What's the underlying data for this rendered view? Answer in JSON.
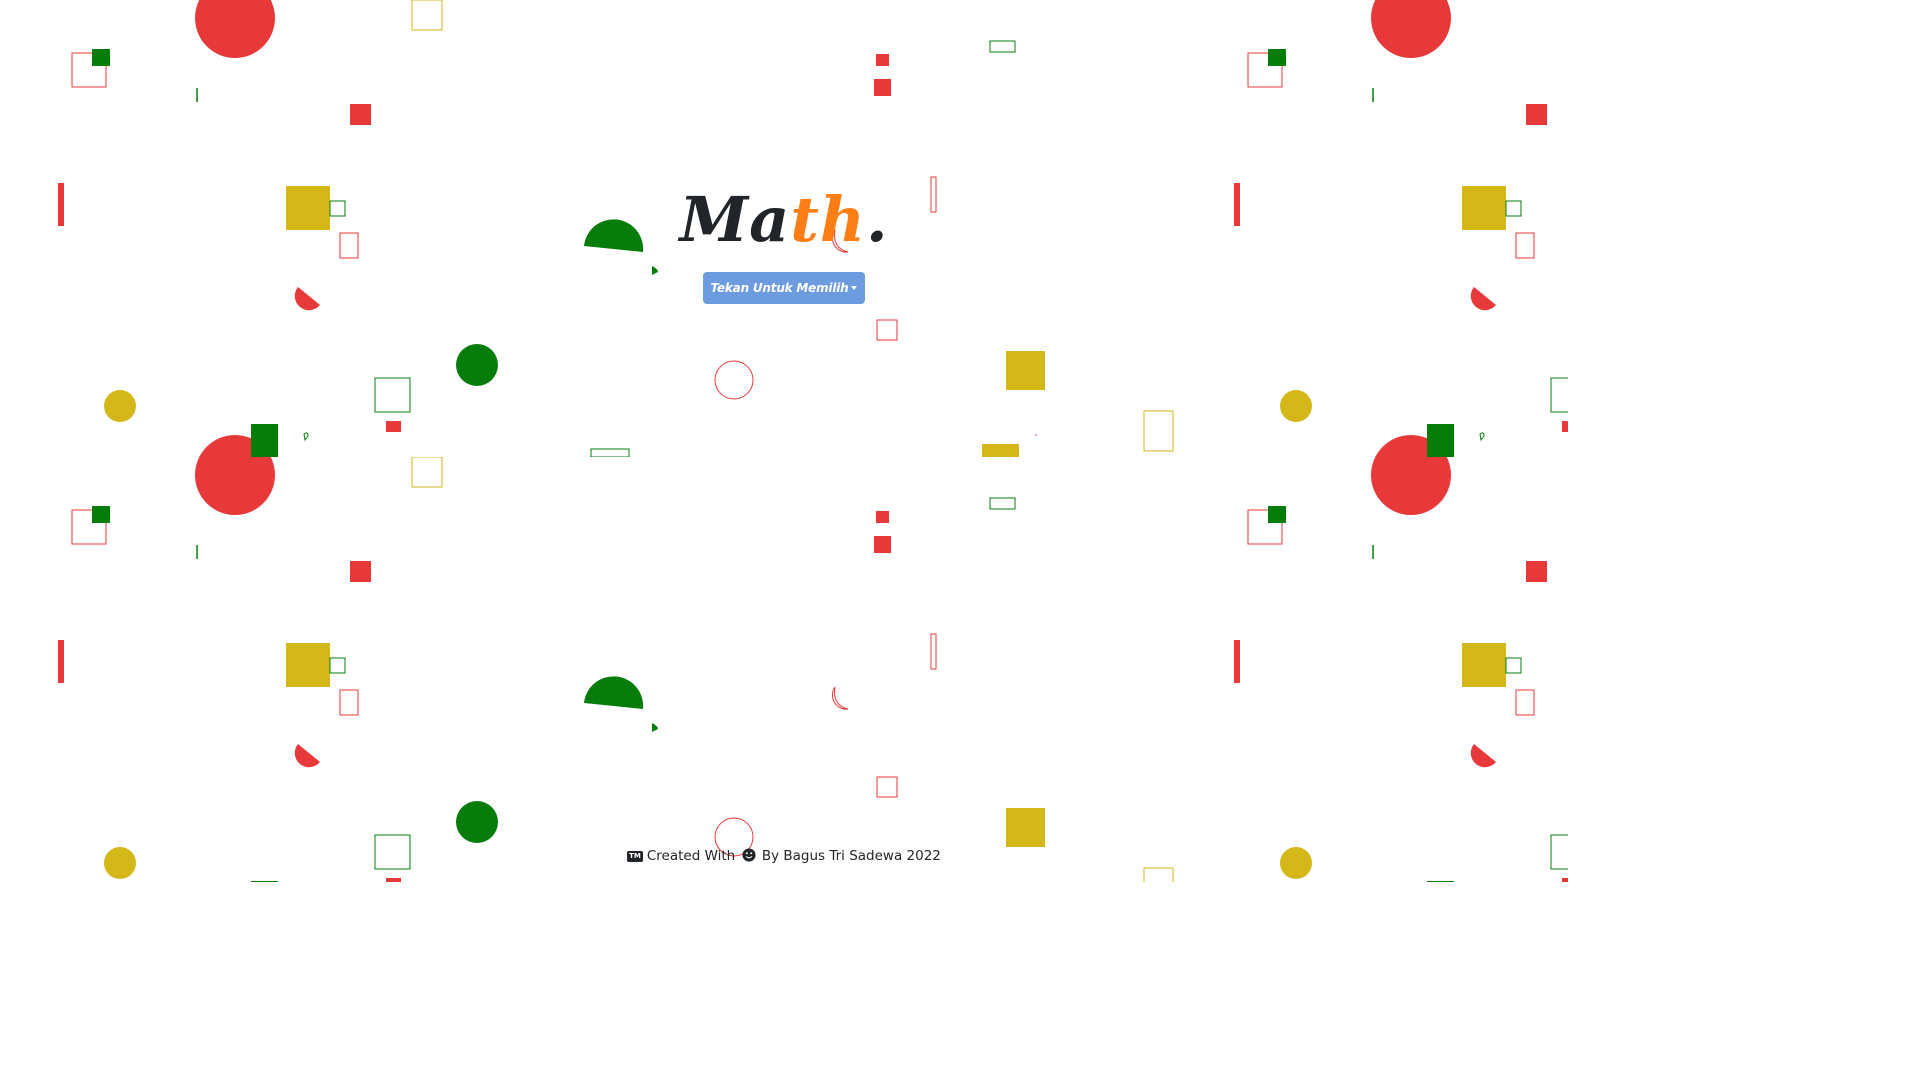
{
  "brand": {
    "logo_main": "Ma",
    "logo_accent": "th",
    "logo_dot": "."
  },
  "menu": {
    "dropdown_label": "Tekan Untuk Memilih"
  },
  "footer": {
    "tm_label": "TM",
    "created_with": "Created With",
    "by_text": "By Bagus Tri Sadewa 2022"
  },
  "colors": {
    "red": "#e8393a",
    "green": "#067d0b",
    "yellow": "#d4b718",
    "button": "#6c9be0",
    "logo_accent": "#fd7e14"
  },
  "icons": {
    "footer_tm": "trademark-icon",
    "footer_smile": "smile-icon",
    "dropdown_caret": "caret-down-icon"
  }
}
